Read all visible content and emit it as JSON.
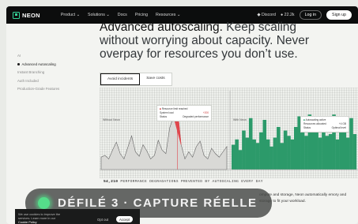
{
  "nav": {
    "brand": "NEON",
    "items": [
      "Product ⌄",
      "Solutions ⌄",
      "Docs",
      "Pricing",
      "Resources ⌄"
    ],
    "discord": "Discord",
    "github_stars": "22.2k",
    "login": "Log in",
    "signup": "Sign up"
  },
  "hero": {
    "line1_clipped": "Advanced autoscaling.",
    "line1_rest": " Keep scaling",
    "line2": "without worrying about capacity. Never",
    "line3": "overpay for resources you don’t use."
  },
  "sidenav": {
    "items": [
      "AI",
      "Advanced Autoscaling",
      "Instant Branching",
      "Auth Included",
      "Production-Grade Features"
    ],
    "active_index": 1
  },
  "tabs": {
    "items": [
      "Avoid incidents",
      "Save costs"
    ],
    "active_index": 0
  },
  "chart_data": {
    "type": "area",
    "left_panel_label": "Without Neon",
    "right_panel_label": "With Neon",
    "left_values": [
      14,
      16,
      12,
      22,
      31,
      18,
      12,
      25,
      38,
      20,
      15,
      28,
      21,
      12,
      16,
      33,
      22,
      18,
      47,
      60,
      70,
      28,
      12,
      20,
      14,
      26,
      32,
      16,
      12,
      24,
      18,
      14,
      20,
      26
    ],
    "right_values": [
      28,
      34,
      22,
      44,
      36,
      58,
      34,
      30,
      42,
      56,
      34,
      26,
      36,
      48,
      30,
      44,
      38,
      34,
      48,
      60,
      50,
      38,
      62,
      42,
      56,
      36,
      50,
      38,
      40,
      62,
      34,
      46,
      42,
      36,
      58,
      40
    ],
    "ylim": [
      0,
      80
    ],
    "left_card": {
      "title": "Resource limit reached",
      "rows": [
        {
          "label": "System load",
          "value": "+200"
        },
        {
          "label": "Status",
          "value": "Degraded performance"
        }
      ]
    },
    "right_card": {
      "title": "Autoscaling active",
      "rows": [
        {
          "label": "Resources allocated",
          "value": "+4 GB"
        },
        {
          "label": "Status",
          "value": "Optimal level"
        }
      ]
    },
    "colors": {
      "left_fill": "#d9d9d6",
      "left_stroke": "#666666",
      "left_spike": "#e0474d",
      "right_fill": "#2c9a6a"
    }
  },
  "stats_caption": {
    "count": "54,210",
    "text": " PERFORMANCE DEGRADATIONS PREVENTED BY AUTOSCALING EVERY DAY"
  },
  "paragraph": "ompute and storage, Neon automatically emory and storage to fit your workload.",
  "overlay": {
    "text": "DÉFILÉ 3 · CAPTURE RÉELLE",
    "dot_color": "#55dd8a"
  },
  "cookie": {
    "line1": "We use cookies to improve the",
    "line2": "services. Learn more in our",
    "link": "Cookie Policy",
    "optout": "Opt out",
    "accept": "Accept"
  }
}
